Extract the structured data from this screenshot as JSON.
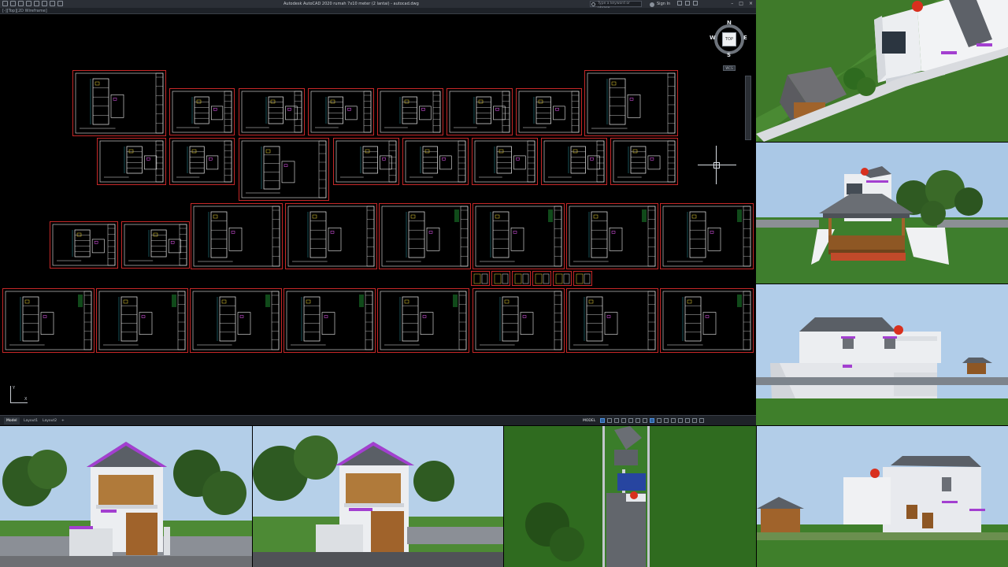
{
  "app": {
    "title": "Autodesk AutoCAD 2020   rumah 7x10 meter (2 lantai) - autocad.dwg",
    "search_placeholder": "Type a keyword or phrase",
    "signin_label": "Sign In",
    "view_label": "[-][Top][2D Wireframe]"
  },
  "viewcube": {
    "face": "TOP",
    "north": "N",
    "south": "S",
    "east": "E",
    "west": "W",
    "wcs": "WCS"
  },
  "ucs": {
    "x": "X",
    "y": "Y"
  },
  "layout_tabs": [
    {
      "label": "Model",
      "active": true
    },
    {
      "label": "Layout1",
      "active": false
    },
    {
      "label": "Layout2",
      "active": false
    },
    {
      "label": "+",
      "active": false
    }
  ],
  "status_bar": {
    "model_label": "MODEL"
  },
  "window_controls": {
    "minimize": "–",
    "maximize": "□",
    "close": "×"
  },
  "colors": {
    "sheet_border": "#c62828",
    "sky": "#a9c6e6",
    "grass": "#3d7d2c",
    "wall": "#e6e8ec",
    "roof": "#5a5f66",
    "accent_trim": "#a33fd0",
    "wood": "#a0632b",
    "water_tank": "#d8301e"
  },
  "renders": [
    {
      "name": "render-aerial-side",
      "view": "aerial-side"
    },
    {
      "name": "render-rear-gazebo",
      "view": "rear-gazebo"
    },
    {
      "name": "render-side-elevation",
      "view": "side-elevation"
    },
    {
      "name": "render-front-left",
      "view": "front"
    },
    {
      "name": "render-front-right",
      "view": "front-angle"
    },
    {
      "name": "render-top-view",
      "view": "top"
    },
    {
      "name": "render-side-gazebo",
      "view": "side-gazebo"
    }
  ]
}
